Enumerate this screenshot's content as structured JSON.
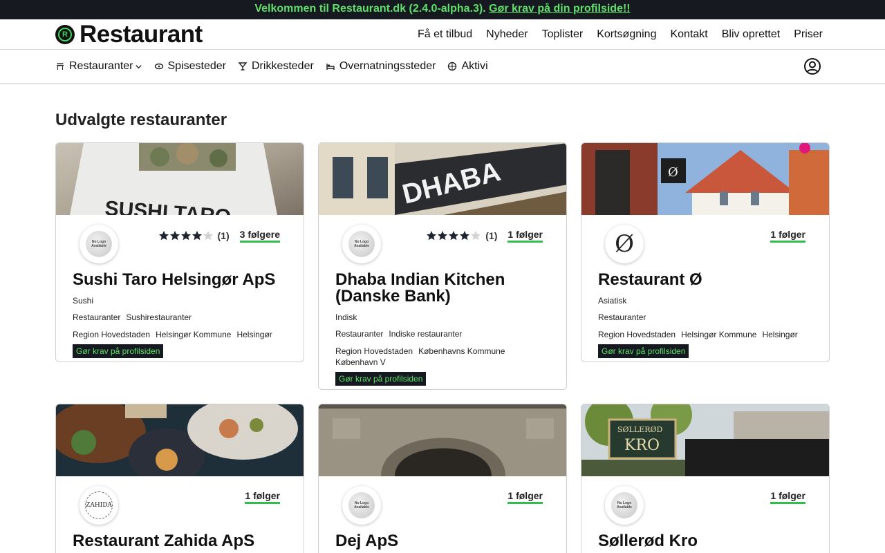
{
  "banner": {
    "text": "Velkommen til Restaurant.dk (2.4.0-alpha.3).",
    "link": "Gør krav på din profilside!!"
  },
  "header": {
    "logo_text": "Restaurant",
    "nav": [
      "Få et tilbud",
      "Nyheder",
      "Toplister",
      "Kortsøgning",
      "Kontakt",
      "Bliv oprettet",
      "Priser"
    ]
  },
  "categories": [
    {
      "label": "Restauranter",
      "icon": "restaurant-icon"
    },
    {
      "label": "Spisesteder",
      "icon": "food-icon"
    },
    {
      "label": "Drikkesteder",
      "icon": "cocktail-icon"
    },
    {
      "label": "Overnatningssteder",
      "icon": "bed-icon"
    },
    {
      "label": "Aktivi",
      "icon": "activity-icon"
    }
  ],
  "section_title": "Udvalgte restauranter",
  "cards": [
    {
      "name": "Sushi Taro Helsingør ApS",
      "logo": "no-logo",
      "logo_text": "No Logo Available",
      "rating": 4,
      "rating_count": "(1)",
      "followers": "3 følgere",
      "cuisine": "Sushi",
      "types": [
        "Restauranter",
        "Sushirestauranter"
      ],
      "locations": [
        "Region Hovedstaden",
        "Helsingør Kommune",
        "Helsingør"
      ],
      "claim": "Gør krav på profilsiden"
    },
    {
      "name": "Dhaba Indian Kitchen (Danske Bank)",
      "logo": "no-logo",
      "logo_text": "No Logo Available",
      "rating": 4,
      "rating_count": "(1)",
      "followers": "1 følger",
      "cuisine": "Indisk",
      "types": [
        "Restauranter",
        "Indiske restauranter"
      ],
      "locations": [
        "Region Hovedstaden",
        "Københavns Kommune",
        "København V"
      ],
      "claim": "Gør krav på profilsiden"
    },
    {
      "name": "Restaurant Ø",
      "logo": "text",
      "logo_text": "Ø",
      "followers": "1 følger",
      "cuisine": "Asiatisk",
      "types": [
        "Restauranter"
      ],
      "locations": [
        "Region Hovedstaden",
        "Helsingør Kommune",
        "Helsingør"
      ],
      "claim": "Gør krav på profilsiden"
    },
    {
      "name": "Restaurant Zahida ApS",
      "logo": "zahida",
      "logo_text": "ZAHIDA",
      "followers": "1 følger"
    },
    {
      "name": "Dej ApS",
      "logo": "no-logo",
      "logo_text": "No Logo Available",
      "followers": "1 følger"
    },
    {
      "name": "Søllerød Kro",
      "logo": "no-logo",
      "logo_text": "No Logo Available",
      "followers": "1 følger",
      "sign_text": [
        "SØLLERØD",
        "KRO"
      ]
    }
  ],
  "colors": {
    "banner_bg": "#16191f",
    "accent_green": "#5ee06a",
    "underline_green": "#2fbe4a"
  }
}
